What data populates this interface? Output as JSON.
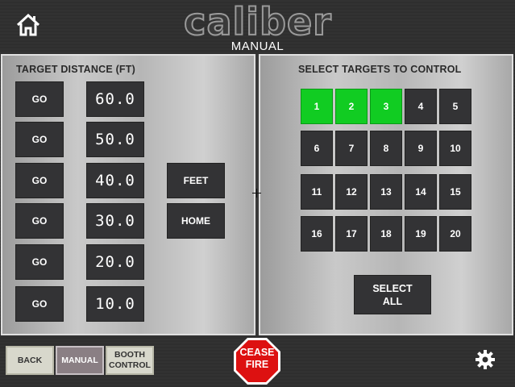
{
  "header": {
    "logo_text": "caliber",
    "mode_title": "MANUAL"
  },
  "left_panel": {
    "title": "TARGET DISTANCE   (FT)",
    "rows": [
      {
        "go_label": "GO",
        "distance": "60.0"
      },
      {
        "go_label": "GO",
        "distance": "50.0"
      },
      {
        "go_label": "GO",
        "distance": "40.0"
      },
      {
        "go_label": "GO",
        "distance": "30.0"
      },
      {
        "go_label": "GO",
        "distance": "20.0"
      },
      {
        "go_label": "GO",
        "distance": "10.0"
      }
    ],
    "feet_label": "FEET",
    "home_label": "HOME"
  },
  "right_panel": {
    "title": "SELECT TARGETS TO CONTROL",
    "targets": [
      "1",
      "2",
      "3",
      "4",
      "5",
      "6",
      "7",
      "8",
      "9",
      "10",
      "11",
      "12",
      "13",
      "14",
      "15",
      "16",
      "17",
      "18",
      "19",
      "20"
    ],
    "active_targets": [
      "1",
      "2",
      "3"
    ],
    "select_all_line1": "SELECT",
    "select_all_line2": "ALL"
  },
  "footer": {
    "back_label": "BACK",
    "manual_label": "MANUAL",
    "booth_line1": "BOOTH",
    "booth_line2": "CONTROL",
    "cease_line1": "CEASE",
    "cease_line2": "FIRE"
  },
  "colors": {
    "active_target": "#11cc22",
    "button": "#333335",
    "cease_fire": "#dd1111"
  },
  "icons": {
    "home": "home-icon",
    "settings": "gear-icon",
    "cease": "stop-octagon-icon"
  }
}
